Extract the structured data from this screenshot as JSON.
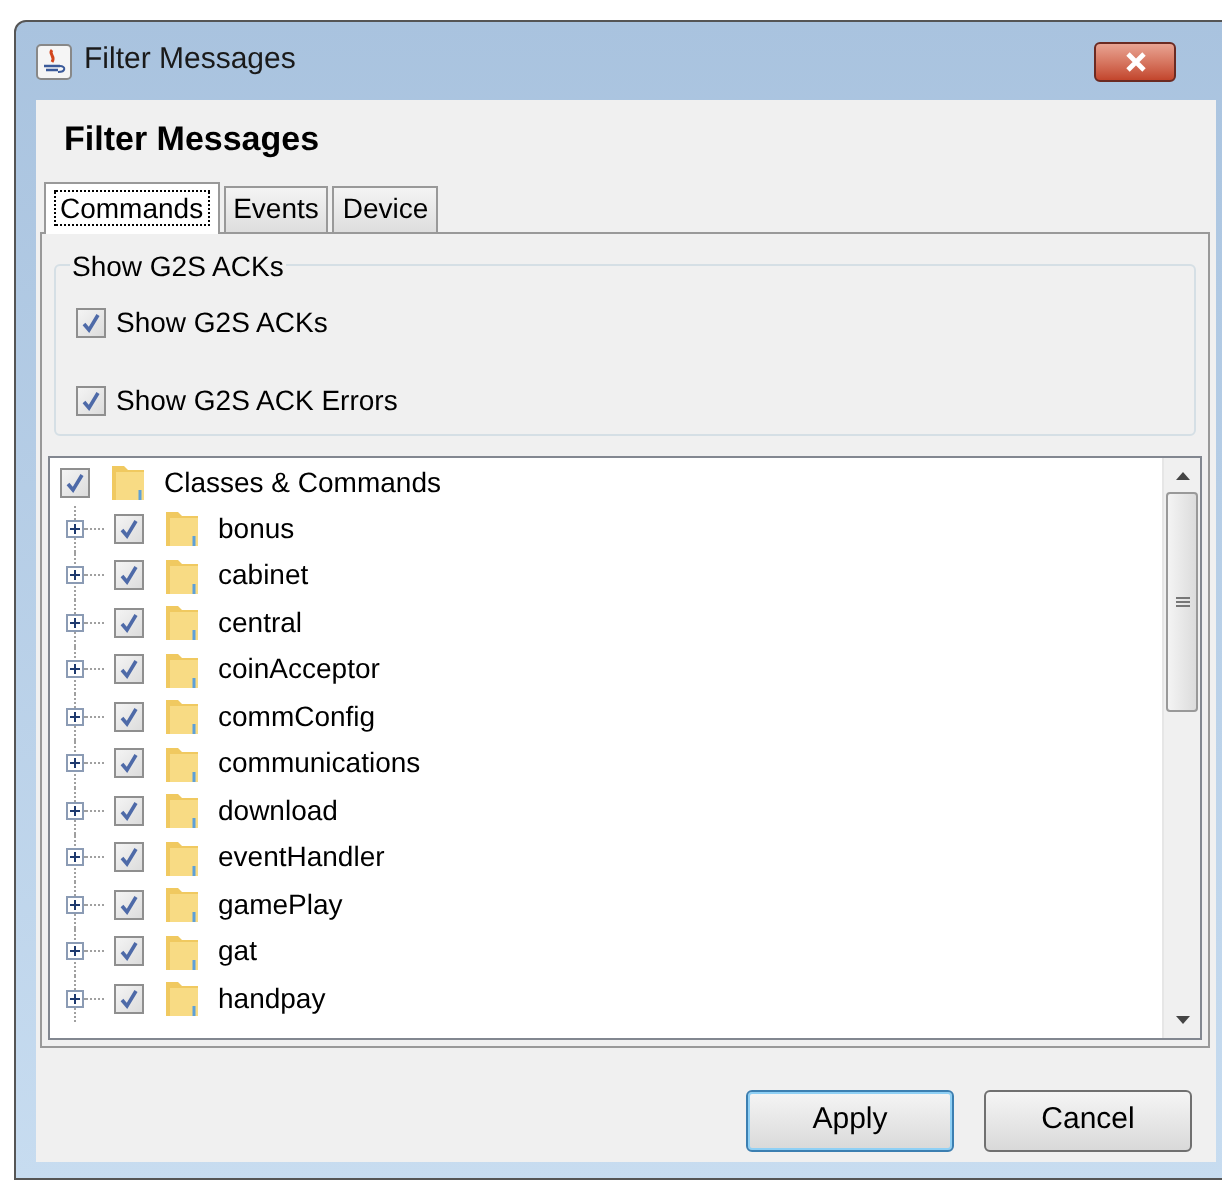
{
  "window": {
    "title": "Filter Messages"
  },
  "header": "Filter Messages",
  "tabs": [
    {
      "label": "Commands",
      "selected": true
    },
    {
      "label": "Events",
      "selected": false
    },
    {
      "label": "Device",
      "selected": false
    }
  ],
  "group": {
    "title": "Show G2S ACKs",
    "options": [
      {
        "label": "Show G2S ACKs",
        "checked": true
      },
      {
        "label": "Show G2S ACK Errors",
        "checked": true
      }
    ]
  },
  "tree": {
    "label": "Classes & Commands",
    "checked": true,
    "children": [
      {
        "label": "bonus",
        "checked": true,
        "expanded": false
      },
      {
        "label": "cabinet",
        "checked": true,
        "expanded": false
      },
      {
        "label": "central",
        "checked": true,
        "expanded": false
      },
      {
        "label": "coinAcceptor",
        "checked": true,
        "expanded": false
      },
      {
        "label": "commConfig",
        "checked": true,
        "expanded": false
      },
      {
        "label": "communications",
        "checked": true,
        "expanded": false
      },
      {
        "label": "download",
        "checked": true,
        "expanded": false
      },
      {
        "label": "eventHandler",
        "checked": true,
        "expanded": false
      },
      {
        "label": "gamePlay",
        "checked": true,
        "expanded": false
      },
      {
        "label": "gat",
        "checked": true,
        "expanded": false
      },
      {
        "label": "handpay",
        "checked": true,
        "expanded": false
      }
    ]
  },
  "buttons": [
    {
      "label": "Apply",
      "kind": "default"
    },
    {
      "label": "Cancel",
      "kind": "normal"
    }
  ]
}
